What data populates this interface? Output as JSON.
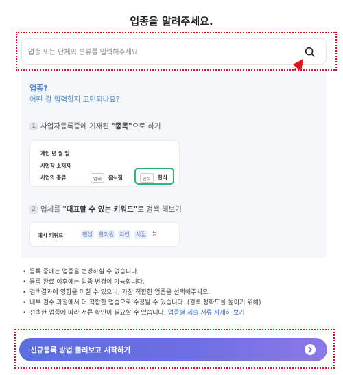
{
  "page": {
    "title": "업종을 알려주세요."
  },
  "search": {
    "placeholder": "업종 또는 단체의 분류를 입력해주세요",
    "value": ""
  },
  "guide": {
    "question": "업종?",
    "sub": "어떤 걸 입력할지 고민되나요?",
    "step1": {
      "num": "1",
      "pre": "사업자등록증에 기재된 ",
      "bold": "\"종목\"",
      "post": "으로 하기"
    },
    "card1": {
      "row1": "개업 년 월 일",
      "row2": "사업장 소재지",
      "row3": "사업의 종류",
      "tag1": "업태",
      "val1": "음식점",
      "tag2": "종목",
      "val2": "한식"
    },
    "step2": {
      "num": "2",
      "pre": "업체를 ",
      "bold": "\"대표할 수 있는 키워드\"",
      "post": "로 검색 해보기"
    },
    "card2": {
      "label": "예시 키워드",
      "keywords": [
        "펜션",
        "한의원",
        "치킨",
        "서점"
      ],
      "etc": "등"
    }
  },
  "notes": [
    "등록 중에는 업종을 변경하실 수 없습니다.",
    "등록 완료 이후에는 업종 변경이 가능합니다.",
    "검색결과에 영향을 미칠 수 있으니, 가장 적합한 업종을 선택해주세요.",
    "내부 검수 과정에서 더 적합한 업종으로 수정될 수 있습니다. (검색 정확도를 높이기 위해)",
    "선택한 업종에 따라 서류 확인이 필요할 수 있습니다. "
  ],
  "notes_link": "업종별 제출 서류 자세히 보기",
  "cta": {
    "label": "신규등록 방법 둘러보고 시작하기"
  },
  "colors": {
    "accent": "#5b6fe0",
    "highlight": "#d8141c",
    "green": "#2bb673",
    "link": "#3b6fd1"
  }
}
